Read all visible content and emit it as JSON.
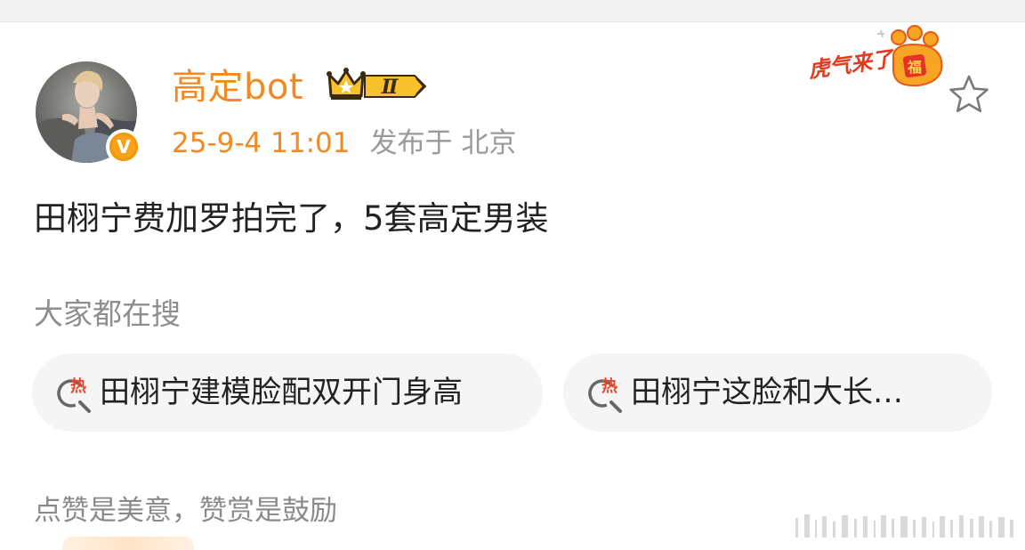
{
  "post": {
    "author": {
      "name": "高定bot",
      "verified_icon": "verified-v-icon",
      "member_badge": {
        "icon": "crown-icon",
        "level": "Ⅱ"
      }
    },
    "meta": {
      "time": "25-9-4 11:01",
      "source": "发布于 北京"
    },
    "decoration": {
      "icon": "tiger-paw-sticker",
      "text": "虎气来了",
      "stamp": "福"
    },
    "favorite_icon": "star-outline-icon",
    "content": "田栩宁费加罗拍完了，5套高定男装"
  },
  "search": {
    "title": "大家都在搜",
    "items": [
      {
        "icon": "hot-search-icon",
        "icon_text": "热",
        "label": "田栩宁建模脸配双开门身高"
      },
      {
        "icon": "hot-search-icon",
        "icon_text": "热",
        "label": "田栩宁这脸和大长…"
      }
    ]
  },
  "footer": {
    "text": "点赞是美意，赞赏是鼓励"
  },
  "colors": {
    "accent": "#f08a24",
    "text": "#222222",
    "muted": "#8e8e8e",
    "chip_bg": "#f5f5f5",
    "hot_red": "#e8452c"
  }
}
